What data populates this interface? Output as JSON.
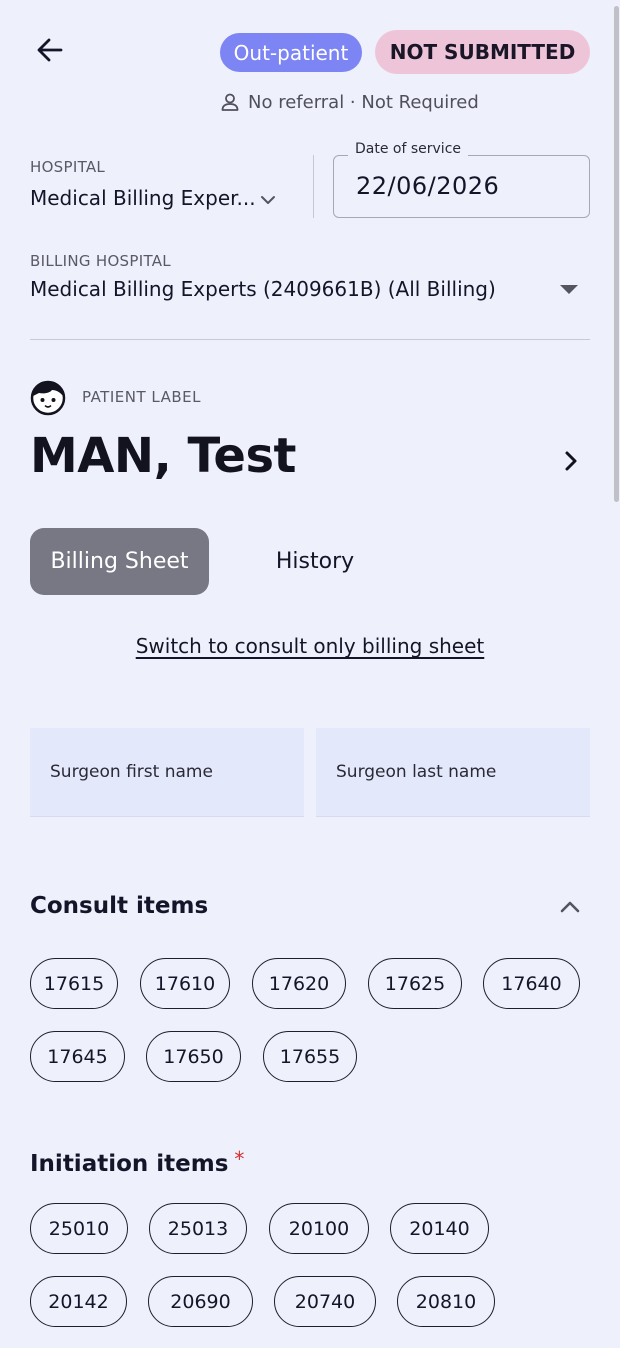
{
  "header": {
    "back_icon": "arrow-left-icon",
    "visit_type": "Out-patient",
    "status": "NOT SUBMITTED",
    "referral_icon": "person-icon",
    "referral_text": "No referral · Not Required",
    "colors": {
      "visit_type_bg": "#7c85f3",
      "status_bg": "#eec5d8"
    }
  },
  "hospital": {
    "label": "HOSPITAL",
    "value": "Medical Billing Exper...",
    "chevron_icon": "chevron-down-icon"
  },
  "date_of_service": {
    "label": "Date of service",
    "value": "22/06/2026"
  },
  "billing_hospital": {
    "label": "BILLING HOSPITAL",
    "value": "Medical Billing Experts (2409661B) (All Billing)",
    "caret_icon": "caret-down-icon"
  },
  "patient": {
    "avatar_icon": "child-face-icon",
    "label": "PATIENT LABEL",
    "name": "MAN, Test",
    "chevron_icon": "chevron-right-icon"
  },
  "tabs": [
    {
      "label": "Billing Sheet",
      "active": true
    },
    {
      "label": "History",
      "active": false
    }
  ],
  "switch_link": "Switch to consult only billing sheet",
  "surgeon": {
    "first_placeholder": "Surgeon first name",
    "last_placeholder": "Surgeon last name"
  },
  "consult_items": {
    "title": "Consult items",
    "collapse_icon": "chevron-up-icon",
    "items": [
      "17615",
      "17610",
      "17620",
      "17625",
      "17640",
      "17645",
      "17650",
      "17655"
    ]
  },
  "initiation_items": {
    "title": "Initiation items",
    "required_mark": "*",
    "items": [
      "25010",
      "25013",
      "20100",
      "20140",
      "20142",
      "20690",
      "20740",
      "20810"
    ]
  }
}
